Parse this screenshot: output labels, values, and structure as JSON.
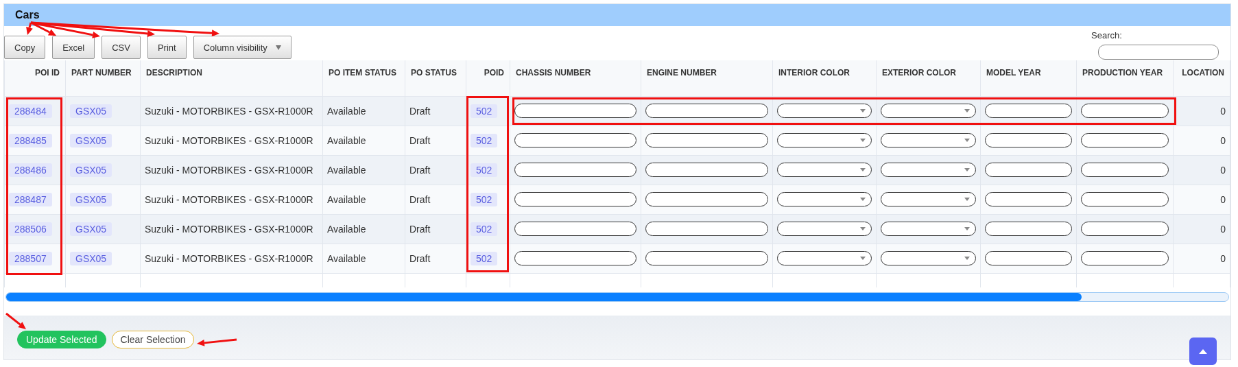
{
  "panel": {
    "title": "Cars"
  },
  "toolbar": {
    "buttons": [
      {
        "label": "Copy",
        "kind": "plain"
      },
      {
        "label": "Excel",
        "kind": "plain"
      },
      {
        "label": "CSV",
        "kind": "plain"
      },
      {
        "label": "Print",
        "kind": "plain"
      },
      {
        "label": "Column visibility",
        "kind": "dropdown"
      }
    ],
    "search": {
      "label": "Search:"
    }
  },
  "table": {
    "columns": [
      {
        "label": "POI ID",
        "kind": "id"
      },
      {
        "label": "PART NUMBER",
        "kind": "badge"
      },
      {
        "label": "DESCRIPTION",
        "kind": "text"
      },
      {
        "label": "PO ITEM STATUS",
        "kind": "text"
      },
      {
        "label": "PO STATUS",
        "kind": "text"
      },
      {
        "label": "POID",
        "kind": "id"
      },
      {
        "label": "CHASSIS NUMBER",
        "kind": "field"
      },
      {
        "label": "ENGINE NUMBER",
        "kind": "field"
      },
      {
        "label": "INTERIOR COLOR",
        "kind": "select"
      },
      {
        "label": "EXTERIOR COLOR",
        "kind": "select"
      },
      {
        "label": "MODEL YEAR",
        "kind": "field"
      },
      {
        "label": "PRODUCTION YEAR",
        "kind": "field"
      },
      {
        "label": "LOCATION",
        "kind": "number"
      }
    ],
    "rows": [
      {
        "cells": [
          "288484",
          "GSX05",
          "Suzuki - MOTORBIKES - GSX-R1000R",
          "Available",
          "Draft",
          "502",
          "0"
        ]
      },
      {
        "cells": [
          "288485",
          "GSX05",
          "Suzuki - MOTORBIKES - GSX-R1000R",
          "Available",
          "Draft",
          "502",
          "0"
        ]
      },
      {
        "cells": [
          "288486",
          "GSX05",
          "Suzuki - MOTORBIKES - GSX-R1000R",
          "Available",
          "Draft",
          "502",
          "0"
        ]
      },
      {
        "cells": [
          "288487",
          "GSX05",
          "Suzuki - MOTORBIKES - GSX-R1000R",
          "Available",
          "Draft",
          "502",
          "0"
        ]
      },
      {
        "cells": [
          "288506",
          "GSX05",
          "Suzuki - MOTORBIKES - GSX-R1000R",
          "Available",
          "Draft",
          "502",
          "0"
        ]
      },
      {
        "cells": [
          "288507",
          "GSX05",
          "Suzuki - MOTORBIKES - GSX-R1000R",
          "Available",
          "Draft",
          "502",
          "0"
        ]
      }
    ]
  },
  "footer": {
    "buttons": [
      {
        "label": "Update Selected",
        "kind": "primary"
      },
      {
        "label": "Clear Selection",
        "kind": "outline"
      }
    ]
  }
}
